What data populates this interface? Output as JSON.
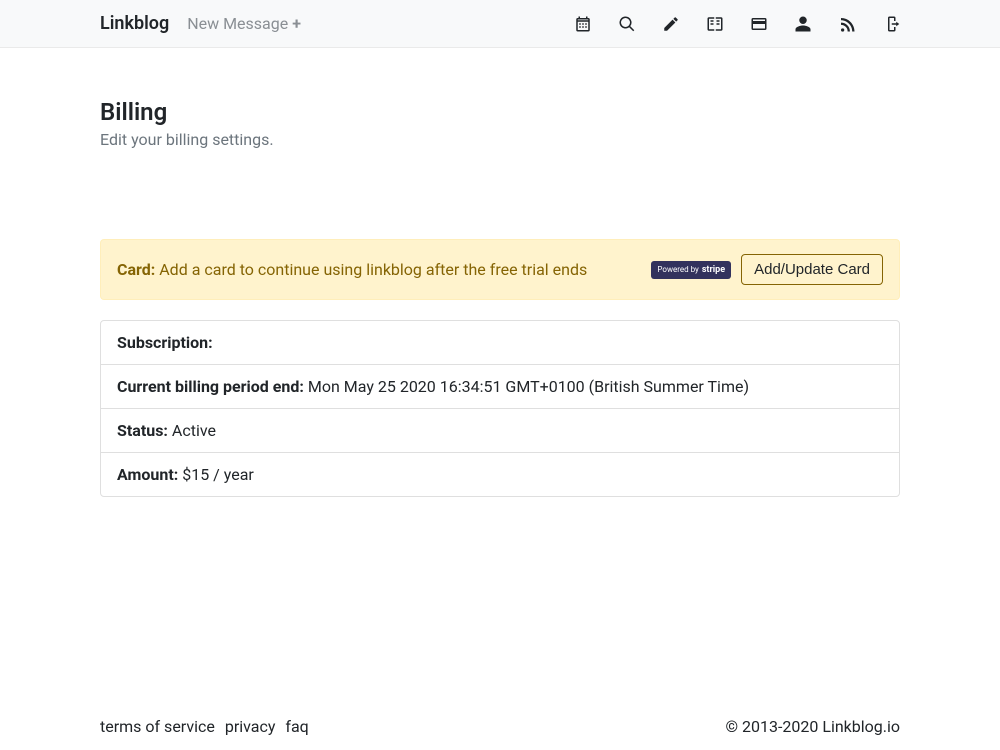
{
  "header": {
    "brand": "Linkblog",
    "new_message_label": "New Message",
    "new_message_plus": "+"
  },
  "nav_icons": {
    "calendar": "calendar-icon",
    "search": "search-icon",
    "pencil": "pencil-icon",
    "book": "book-icon",
    "card": "card-icon",
    "user": "user-icon",
    "rss": "rss-icon",
    "logout": "logout-icon"
  },
  "page": {
    "title": "Billing",
    "subtitle": "Edit your billing settings."
  },
  "alert": {
    "label": "Card:",
    "message": "Add a card to continue using linkblog after the free trial ends",
    "stripe_badge_prefix": "Powered by",
    "stripe_badge_word": "stripe",
    "button_label": "Add/Update Card"
  },
  "subscription": {
    "header_label": "Subscription:",
    "period_label": "Current billing period end:",
    "period_value": "Mon May 25 2020 16:34:51 GMT+0100 (British Summer Time)",
    "status_label": "Status:",
    "status_value": "Active",
    "amount_label": "Amount:",
    "amount_value": "$15 / year"
  },
  "footer": {
    "links": {
      "tos": "terms of service",
      "privacy": "privacy",
      "faq": "faq"
    },
    "copyright": "© 2013-2020 Linkblog.io"
  }
}
